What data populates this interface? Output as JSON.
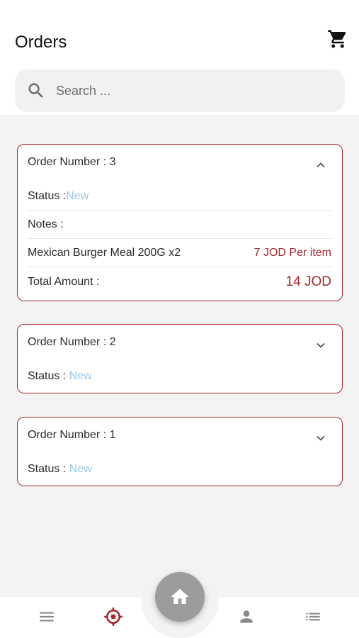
{
  "header": {
    "title": "Orders"
  },
  "search": {
    "placeholder": "Search ..."
  },
  "orders": [
    {
      "number_label": "Order Number  : 3",
      "expanded": true,
      "status_label": "Status :",
      "status_value": "New",
      "notes_label": "Notes :",
      "item_name": "Mexican Burger Meal 200G  x2",
      "item_price": "7 JOD Per item",
      "total_label": "Total Amount :",
      "total_value": "14 JOD"
    },
    {
      "number_label": "Order Number  : 2",
      "expanded": false,
      "status_label": "Status : ",
      "status_value": "New"
    },
    {
      "number_label": "Order Number  : 1",
      "expanded": false,
      "status_label": "Status : ",
      "status_value": "New"
    }
  ],
  "icons": {
    "cart": "cart-icon",
    "search": "search-icon",
    "chevron_up": "chevron-up-icon",
    "chevron_down": "chevron-down-icon",
    "menu": "menu-icon",
    "target": "target-icon",
    "home": "home-icon",
    "person": "person-icon",
    "list": "list-icon"
  },
  "colors": {
    "accent": "#a4262c",
    "status_new": "#9cc6e6",
    "nav_gray": "#8a8a8a",
    "home_button": "#9c9c9c"
  }
}
